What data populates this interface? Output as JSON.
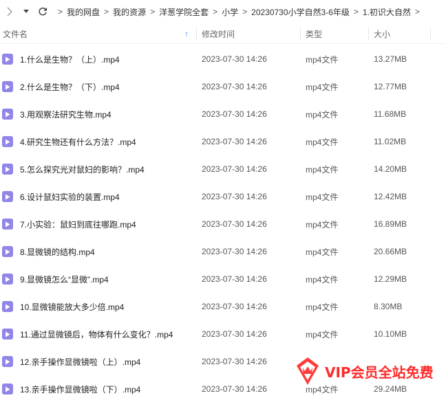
{
  "toolbar": {
    "breadcrumbs": [
      "我的网盘",
      "我的资源",
      "洋葱学院全套",
      "小学",
      "20230730小学自然3-6年级",
      "1.初识大自然"
    ],
    "separator": ">"
  },
  "columns": {
    "name": "文件名",
    "modified": "修改时间",
    "type": "类型",
    "size": "大小"
  },
  "files": [
    {
      "name": "1.什么是生物？（上）.mp4",
      "modified": "2023-07-30 14:26",
      "type": "mp4文件",
      "size": "13.27MB"
    },
    {
      "name": "2.什么是生物？（下）.mp4",
      "modified": "2023-07-30 14:26",
      "type": "mp4文件",
      "size": "12.77MB"
    },
    {
      "name": "3.用观察法研究生物.mp4",
      "modified": "2023-07-30 14:26",
      "type": "mp4文件",
      "size": "11.68MB"
    },
    {
      "name": "4.研究生物还有什么方法？.mp4",
      "modified": "2023-07-30 14:26",
      "type": "mp4文件",
      "size": "11.02MB"
    },
    {
      "name": "5.怎么探究光对鼠妇的影响？.mp4",
      "modified": "2023-07-30 14:26",
      "type": "mp4文件",
      "size": "14.20MB"
    },
    {
      "name": "6.设计鼠妇实验的装置.mp4",
      "modified": "2023-07-30 14:26",
      "type": "mp4文件",
      "size": "12.42MB"
    },
    {
      "name": "7.小实验：鼠妇到底往哪跑.mp4",
      "modified": "2023-07-30 14:26",
      "type": "mp4文件",
      "size": "16.89MB"
    },
    {
      "name": "8.显微镜的结构.mp4",
      "modified": "2023-07-30 14:26",
      "type": "mp4文件",
      "size": "20.66MB"
    },
    {
      "name": "9.显微镜怎么“显微”.mp4",
      "modified": "2023-07-30 14:26",
      "type": "mp4文件",
      "size": "12.29MB"
    },
    {
      "name": "10.显微镜能放大多少倍.mp4",
      "modified": "2023-07-30 14:26",
      "type": "mp4文件",
      "size": "8.30MB"
    },
    {
      "name": "11.通过显微镜后，物体有什么变化？.mp4",
      "modified": "2023-07-30 14:26",
      "type": "mp4文件",
      "size": "10.10MB"
    },
    {
      "name": "12.亲手操作显微镜啦（上）.mp4",
      "modified": "2023-07-30 14:26",
      "type": "",
      "size": ""
    },
    {
      "name": "13.亲手操作显微镜啦（下）.mp4",
      "modified": "2023-07-30 14:26",
      "type": "mp4文件",
      "size": "29.24MB"
    }
  ],
  "watermark": {
    "text": "VIP会员全站免费"
  },
  "colors": {
    "file_icon": "#8f86e8",
    "sort_arrow": "#3a8ee6",
    "watermark": "#ff2a2a"
  },
  "icons": {
    "forward": "chevron-right-icon",
    "dropdown": "caret-down-icon",
    "refresh": "refresh-icon",
    "sort": "sort-ascending-icon",
    "file": "video-file-icon"
  }
}
